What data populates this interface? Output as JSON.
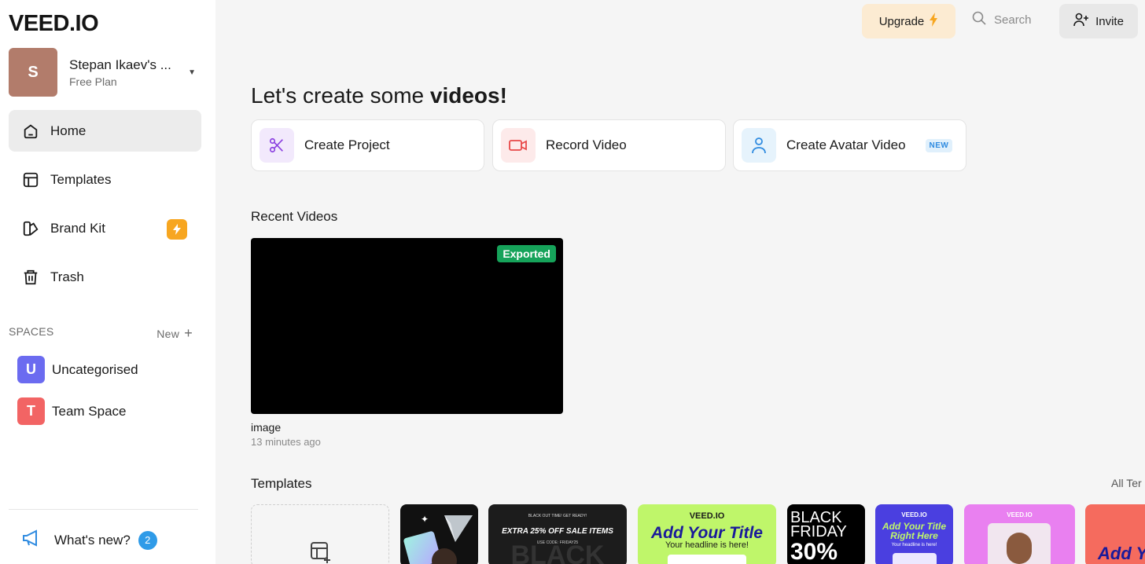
{
  "brand": {
    "logo": "VEED.IO"
  },
  "workspace": {
    "initial": "S",
    "name": "Stepan Ikaev's ...",
    "plan": "Free Plan",
    "avatar_color": "#b27c6b"
  },
  "nav": {
    "items": [
      {
        "label": "Home",
        "icon": "home-icon",
        "active": true
      },
      {
        "label": "Templates",
        "icon": "templates-icon"
      },
      {
        "label": "Brand Kit",
        "icon": "brand-kit-icon",
        "badge_icon": "lightning-icon"
      },
      {
        "label": "Trash",
        "icon": "trash-icon"
      }
    ]
  },
  "spaces": {
    "header": "SPACES",
    "new_label": "New",
    "items": [
      {
        "initial": "U",
        "label": "Uncategorised",
        "color": "#6b6bf0"
      },
      {
        "initial": "T",
        "label": "Team Space",
        "color": "#f26464"
      }
    ]
  },
  "whats_new": {
    "label": "What's new?",
    "count": "2"
  },
  "topbar": {
    "upgrade_label": "Upgrade",
    "search_placeholder": "Search",
    "invite_label": "Invite"
  },
  "main": {
    "headline_prefix": "Let's create some ",
    "headline_bold": "videos!",
    "actions": [
      {
        "label": "Create Project",
        "icon": "scissors-icon",
        "color": "#8a3fe0"
      },
      {
        "label": "Record Video",
        "icon": "video-camera-icon",
        "color": "#e84848"
      },
      {
        "label": "Create Avatar Video",
        "icon": "person-icon",
        "color": "#2f8be0",
        "badge": "NEW"
      }
    ],
    "recent_title": "Recent Videos",
    "recent_videos": [
      {
        "name": "image",
        "time": "13 minutes ago",
        "status": "Exported"
      }
    ],
    "templates_title": "Templates",
    "all_templates_label": "All Ter",
    "template_texts": {
      "t2_top": "BLACK OUT TIME! GET READY!",
      "t2_main": "EXTRA 25% OFF SALE ITEMS",
      "t2_code": "USE CODE: FRIDAY25",
      "t2_big": "BLACK",
      "t3_brand": "VEED.IO",
      "t3_title": "Add Your Title",
      "t3_sub": "Your headline is here!",
      "t4_l1": "BLACK",
      "t4_l2": "FRIDAY",
      "t4_l3": "30%",
      "t5_brand": "VEED.IO",
      "t5_title": "Add Your Title Right Here",
      "t5_sub": "Your headline is here!",
      "t6_brand": "VEED.IO",
      "t7_title": "Add Yo"
    }
  }
}
